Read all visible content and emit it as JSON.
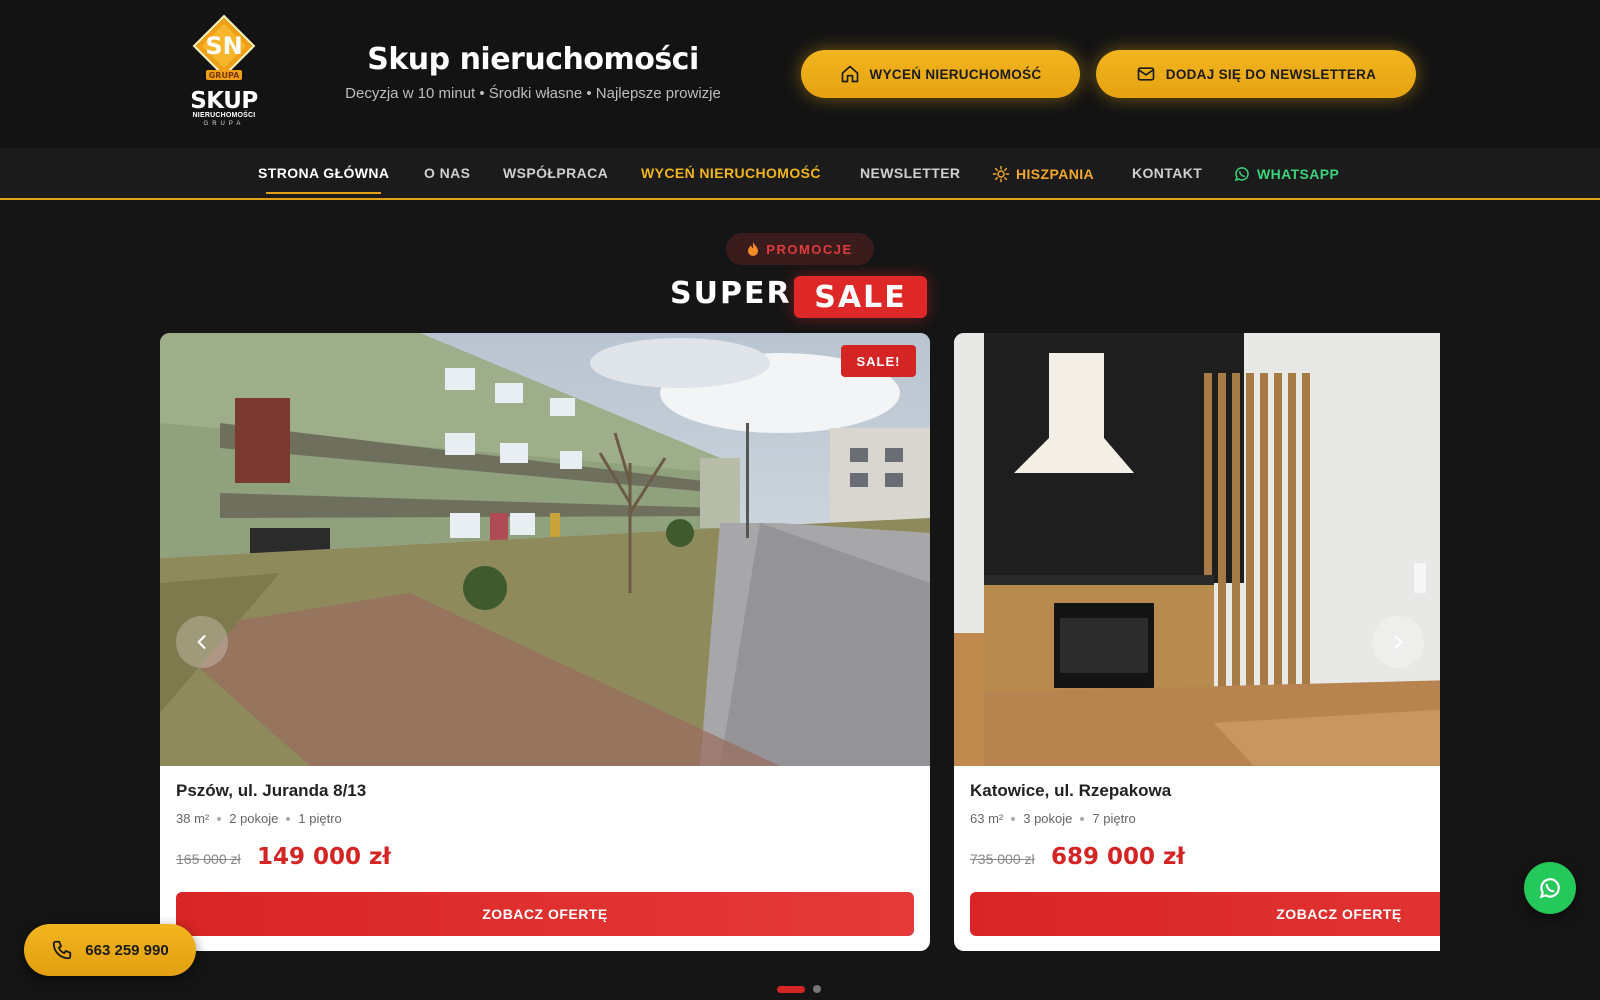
{
  "header": {
    "logo": {
      "emblem_text": "SN",
      "emblem_sub": "GRUPA",
      "brand": "SKUP",
      "brand_sub": "NIERUCHOMOŚCI",
      "brand_sub2": "GRUPA"
    },
    "title": "Skup nieruchomości",
    "tagline": "Decyzja w 10 minut • Środki własne • Najlepsze prowizje",
    "buttons": [
      {
        "label": "WYCEŃ NIERUCHOMOŚĆ",
        "icon": "home-icon"
      },
      {
        "label": "DODAJ SIĘ DO NEWSLETTERA",
        "icon": "mail-icon"
      }
    ]
  },
  "nav": {
    "items": [
      {
        "label": "STRONA GŁÓWNA",
        "active": true
      },
      {
        "label": "O NAS"
      },
      {
        "label": "WSPÓŁPRACA"
      },
      {
        "label": "WYCEŃ NIERUCHOMOŚĆ",
        "highlight": "gold"
      },
      {
        "label": "NEWSLETTER"
      },
      {
        "label": "HISZPANIA",
        "icon": "sun-icon",
        "highlight": "orange"
      },
      {
        "label": "KONTAKT"
      },
      {
        "label": "WHATSAPP",
        "icon": "whatsapp-icon",
        "highlight": "green"
      }
    ]
  },
  "section": {
    "badge": "PROMOCJE",
    "badge_icon": "fire-icon",
    "heading_1": "SUPER",
    "heading_2": "SALE"
  },
  "listings": [
    {
      "tag": "SALE!",
      "title": "Pszów, ul. Juranda 8/13",
      "area": "38 m²",
      "rooms": "2 pokoje",
      "floor": "1 piętro",
      "old_price": "165 000 zł",
      "price": "149 000 zł",
      "cta": "ZOBACZ OFERTĘ"
    },
    {
      "title": "Katowice, ul. Rzepakowa",
      "area": "63 m²",
      "rooms": "3 pokoje",
      "floor": "7 piętro",
      "old_price": "735 000 zł",
      "price": "689 000 zł",
      "cta": "ZOBACZ OFERTĘ"
    }
  ],
  "carousel": {
    "current_page": 1,
    "total_pages": 2
  },
  "floating": {
    "phone": "663 259 990"
  },
  "colors": {
    "gold": "#f2b51e",
    "red": "#d42424",
    "green": "#25c85a",
    "background": "#151515"
  }
}
